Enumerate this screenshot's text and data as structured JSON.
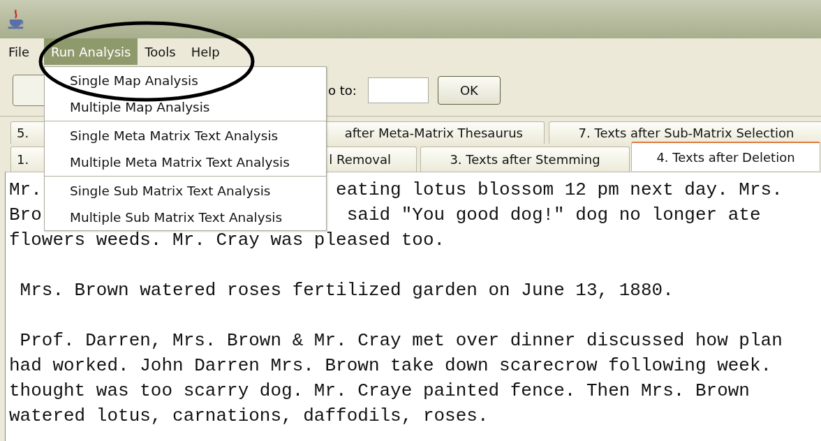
{
  "menu_bar": [
    {
      "label": "File",
      "selected": false
    },
    {
      "label": "Run Analysis",
      "selected": true
    },
    {
      "label": "Tools",
      "selected": false
    },
    {
      "label": "Help",
      "selected": false
    }
  ],
  "toolbar": {
    "goto_label": "o to:",
    "ok_button": "OK"
  },
  "tab_rows": [
    [
      {
        "label": "5.",
        "selected": false
      },
      {
        "label": "after Meta-Matrix Thesaurus",
        "selected": false
      },
      {
        "label": "7. Texts after Sub-Matrix Selection",
        "selected": false
      }
    ],
    [
      {
        "label": "1.",
        "selected": false
      },
      {
        "label": "l Removal",
        "selected": false
      },
      {
        "label": "3. Texts after Stemming",
        "selected": false
      },
      {
        "label": "4. Texts after Deletion",
        "selected": true
      }
    ]
  ],
  "paragraphs": [
    [
      [
        "Mr.",
        "eating lotus blossom 12 pm next day. Mrs."
      ],
      [
        "Bro",
        "said \"You good dog!\" dog no longer ate"
      ],
      [
        "flowers weeds. Mr. Cray was pleased too."
      ]
    ],
    [
      [
        " Mrs. Brown watered roses fertilized garden on June 13, 1880."
      ]
    ],
    [
      [
        " Prof. Darren, Mrs. Brown & Mr. Cray met over dinner discussed how plan"
      ],
      [
        "had worked. John Darren Mrs. Brown take down scarecrow following week."
      ],
      [
        "thought was too scarry dog. Mr. Craye painted fence. Then Mrs. Brown"
      ],
      [
        "watered lotus, carnations, daffodils, roses."
      ]
    ]
  ],
  "dropdown_menu": {
    "groups": [
      [
        "Single Map Analysis",
        "Multiple Map Analysis"
      ],
      [
        "Single Meta Matrix Text Analysis",
        "Multiple Meta Matrix Text Analysis"
      ],
      [
        "Single Sub Matrix Text Analysis",
        "Multiple Sub Matrix Text Analysis"
      ]
    ]
  }
}
